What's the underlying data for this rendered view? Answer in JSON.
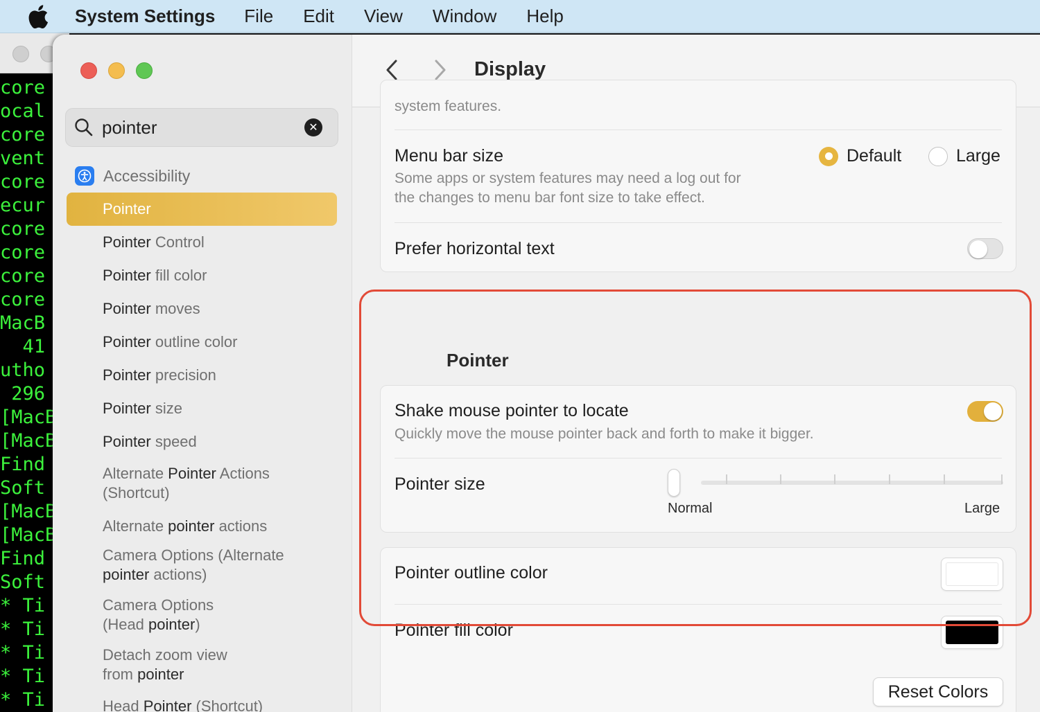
{
  "menubar": {
    "app_name": "System Settings",
    "items": [
      "File",
      "Edit",
      "View",
      "Window",
      "Help"
    ]
  },
  "terminal": {
    "lines": [
      "core",
      "ocal",
      "core",
      "vent",
      "core",
      "ecur",
      "core",
      "core",
      "core",
      "core",
      "MacB",
      "  41",
      "utho",
      " 296",
      "[MacB",
      "[MacB",
      "Find",
      "Soft",
      "[MacB",
      "[MacB",
      "Find",
      "Soft",
      "* Ti",
      "* Ti",
      "* Ti",
      "* Ti",
      "* Ti"
    ]
  },
  "sidebar": {
    "search": {
      "value": "pointer",
      "placeholder": "Search"
    },
    "group_label": "Accessibility",
    "items": [
      {
        "pre": "",
        "hl": "Pointer",
        "post": ""
      },
      {
        "pre": "",
        "hl": "Pointer",
        "post": " Control"
      },
      {
        "pre": "",
        "hl": "Pointer",
        "post": " fill color"
      },
      {
        "pre": "",
        "hl": "Pointer",
        "post": " moves"
      },
      {
        "pre": "",
        "hl": "Pointer",
        "post": " outline color"
      },
      {
        "pre": "",
        "hl": "Pointer",
        "post": " precision"
      },
      {
        "pre": "",
        "hl": "Pointer",
        "post": " size"
      },
      {
        "pre": "",
        "hl": "Pointer",
        "post": " speed"
      },
      {
        "pre": "Alternate ",
        "hl": "Pointer",
        "post": " Actions (Shortcut)"
      },
      {
        "pre": "Alternate ",
        "hl": "pointer",
        "post": " actions"
      },
      {
        "pre": "Camera Options (Alternate ",
        "hl": "pointer",
        "post": " actions)"
      },
      {
        "pre": "Camera Options (Head ",
        "hl": "pointer",
        "post": ")"
      },
      {
        "pre": "Detach zoom view from ",
        "hl": "pointer",
        "post": ""
      },
      {
        "pre": "Head ",
        "hl": "Pointer",
        "post": " (Shortcut)"
      }
    ]
  },
  "header": {
    "title": "Display"
  },
  "text_card": {
    "cutoff_text": "system features.",
    "menu_bar_size": {
      "label": "Menu bar size",
      "description_line1": "Some apps or system features may need a log out for",
      "description_line2": "the changes to menu bar font size to take effect.",
      "options": [
        "Default",
        "Large"
      ],
      "selected": "Default"
    },
    "prefer_horizontal": {
      "label": "Prefer horizontal text",
      "on": false
    }
  },
  "pointer_section": {
    "title": "Pointer",
    "shake": {
      "label": "Shake mouse pointer to locate",
      "description": "Quickly move the mouse pointer back and forth to make it bigger.",
      "on": true
    },
    "size": {
      "label": "Pointer size",
      "min_label": "Normal",
      "max_label": "Large",
      "value_fraction": 0.0
    },
    "outline_color": {
      "label": "Pointer outline color",
      "color": "#ffffff"
    },
    "fill_color": {
      "label": "Pointer fill color",
      "color": "#000000"
    },
    "reset_label": "Reset Colors"
  },
  "colors": {
    "accent": "#e6b540",
    "highlight_border": "#e24a37",
    "terminal_text": "#3cf23c"
  }
}
